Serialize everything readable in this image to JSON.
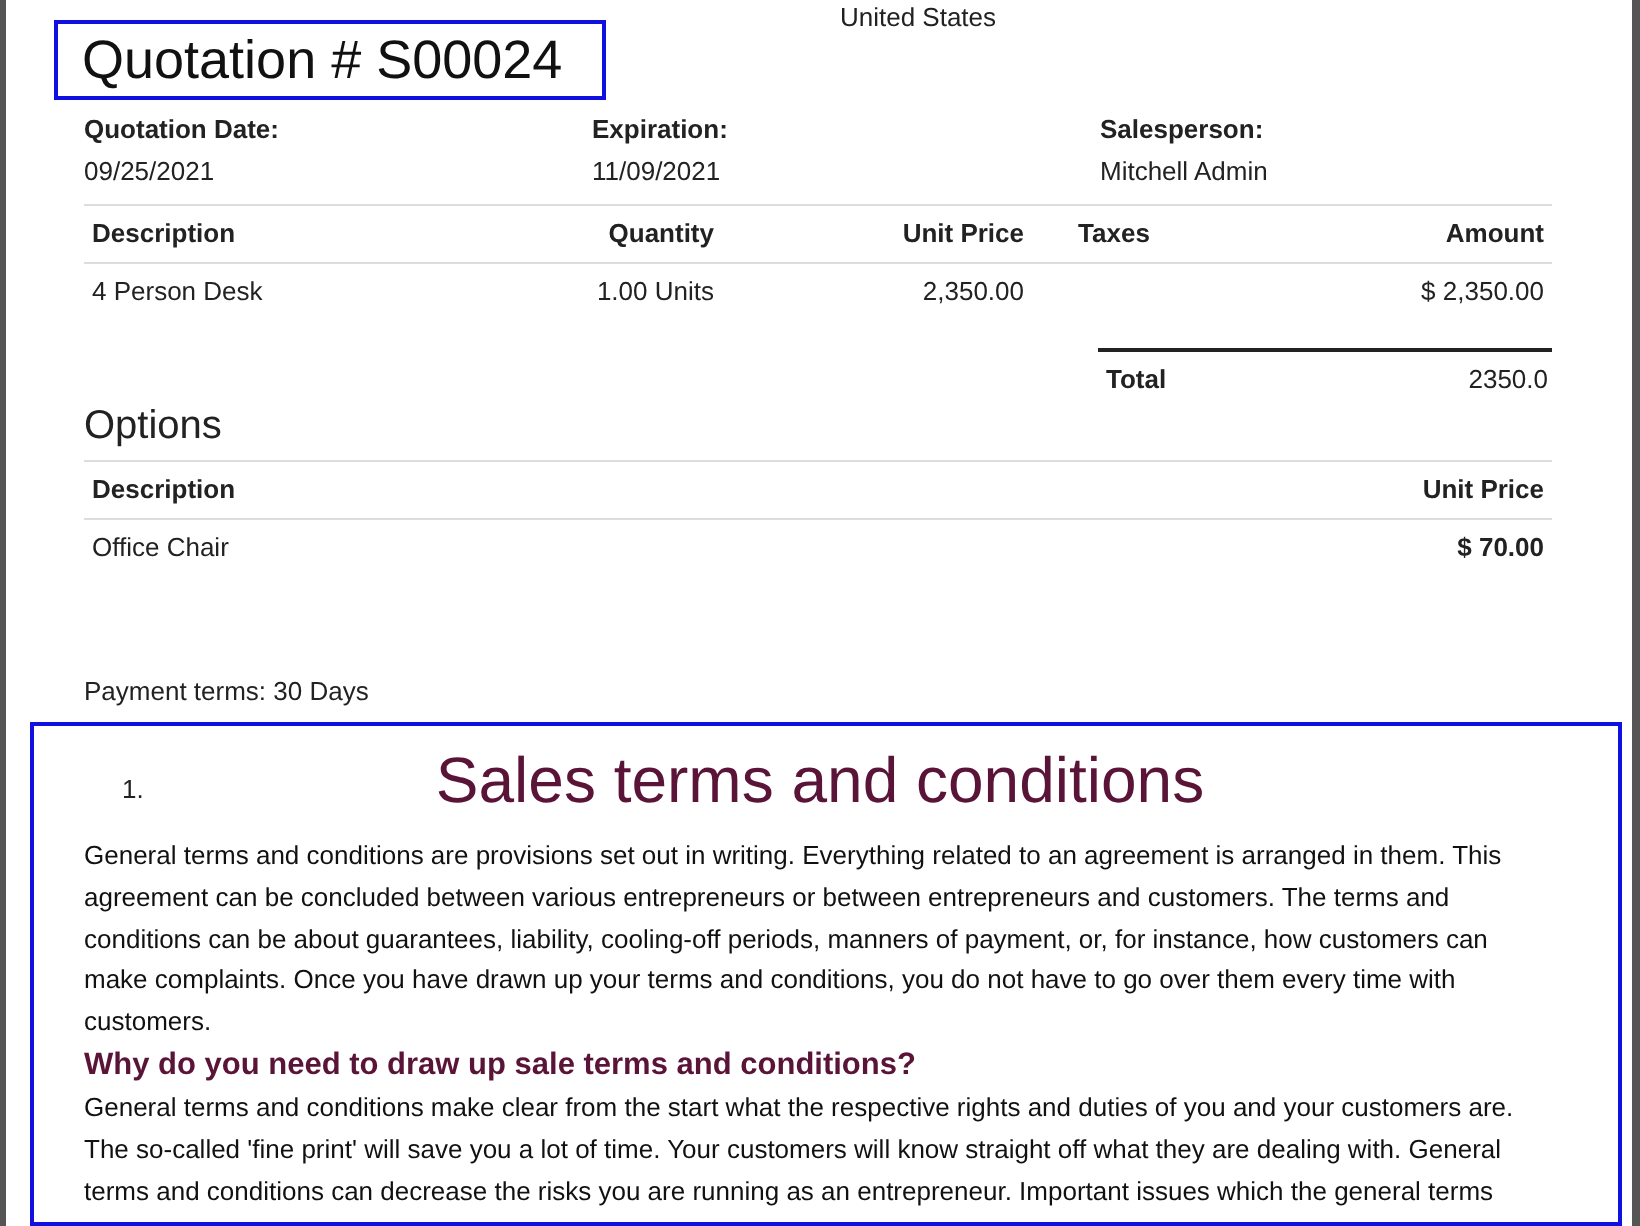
{
  "address_tail": "United States",
  "title": "Quotation # S00024",
  "info": [
    {
      "label": "Quotation Date:",
      "value": "09/25/2021"
    },
    {
      "label": "Expiration:",
      "value": "11/09/2021"
    },
    {
      "label": "Salesperson:",
      "value": "Mitchell Admin"
    }
  ],
  "lines_table": {
    "columns": [
      "Description",
      "Quantity",
      "Unit Price",
      "Taxes",
      "Amount"
    ],
    "rows": [
      [
        "4 Person Desk",
        "1.00 Units",
        "2,350.00",
        "",
        "$ 2,350.00"
      ]
    ]
  },
  "total": {
    "label": "Total",
    "value": "2350.0"
  },
  "options": {
    "title": "Options",
    "columns": [
      "Description",
      "Unit Price"
    ],
    "rows": [
      [
        "Office Chair",
        "$ 70.00"
      ]
    ]
  },
  "payment_terms": "Payment terms: 30 Days",
  "terms": {
    "number": "1.",
    "heading": "Sales terms and conditions",
    "blocks": [
      {
        "kind": "paragraph",
        "text": "General terms and conditions are provisions set out in writing. Everything related to an agreement is arranged in them. This agreement can be concluded between various entrepreneurs or between entrepreneurs and customers. The terms and conditions can be about guarantees, liability, cooling-off periods, manners of payment, or, for instance, how customers can make complaints. Once you have drawn up your terms and conditions, you do not have to go over them every time with customers."
      },
      {
        "kind": "subheading",
        "text": "Why do you need to draw up sale terms and conditions?"
      },
      {
        "kind": "paragraph",
        "text": "General terms and conditions make clear from the start what the respective rights and duties of you and your customers are. The so-called 'fine print' will save you a lot of time. Your customers will know straight off what they are dealing with. General terms and conditions can decrease the risks you are running as an entrepreneur. Important issues which the general terms"
      }
    ]
  }
}
